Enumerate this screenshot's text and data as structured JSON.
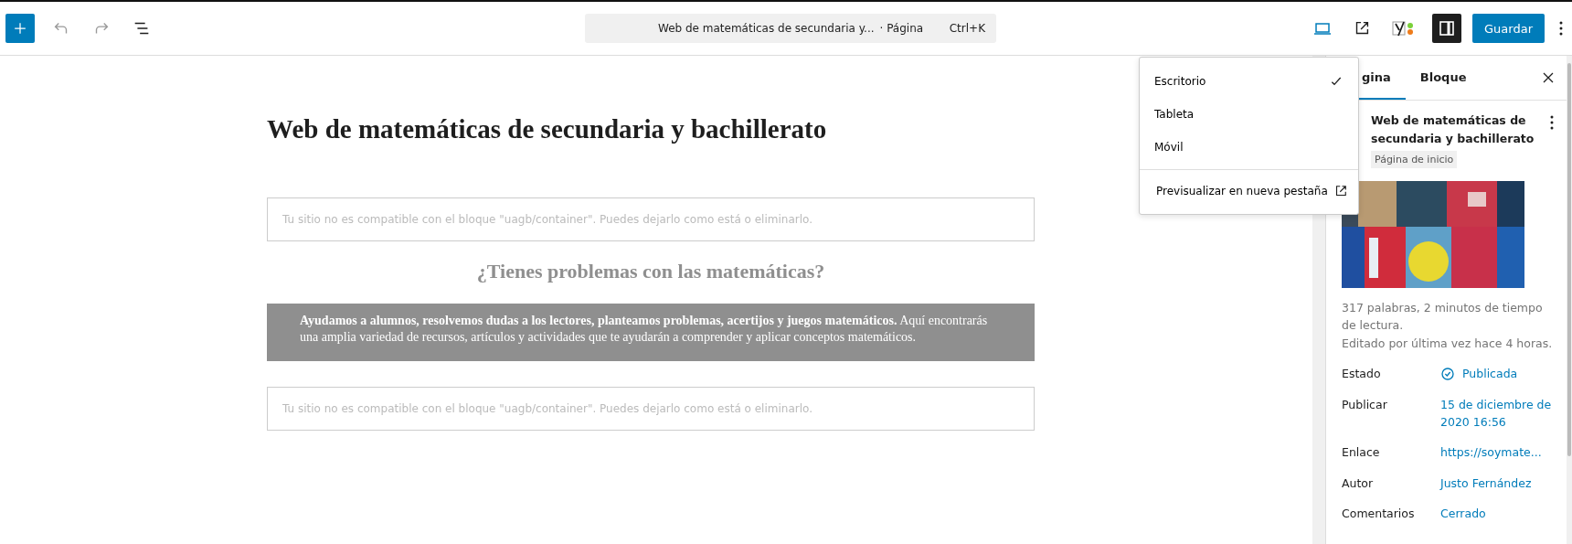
{
  "toolbar": {
    "command_bar": {
      "title": "Web de matemáticas de secundaria y...",
      "type": "· Página",
      "shortcut": "Ctrl+K"
    },
    "save_label": "Guardar"
  },
  "canvas": {
    "title": "Web de matemáticas de secundaria y bachillerato",
    "blocks": [
      {
        "kind": "notice",
        "text": "Tu sitio no es compatible con el bloque \"uagb/container\". Puedes dejarlo como está o eliminarlo."
      },
      {
        "kind": "heading",
        "text": "¿Tienes problemas con las matemáticas?"
      },
      {
        "kind": "banner",
        "text": "**Ayudamos a alumnos, resolvemos dudas a los lectores, planteamos problemas, acertijos y juegos matemáticos.** Aquí encontrarás una amplia variedad de recursos, artículos y actividades que te ayudarán a comprender y aplicar conceptos matemáticos."
      },
      {
        "kind": "notice",
        "text": "Tu sitio no es compatible con el bloque \"uagb/container\". Puedes dejarlo como está o eliminarlo."
      }
    ]
  },
  "preview_menu": {
    "items": [
      {
        "label": "Escritorio",
        "selected": true
      },
      {
        "label": "Tableta",
        "selected": false
      },
      {
        "label": "Móvil",
        "selected": false
      }
    ],
    "footer": "Previsualizar en nueva pestaña"
  },
  "sidebar": {
    "tabs": [
      {
        "label": "gina",
        "selected": true
      },
      {
        "label": "Bloque",
        "selected": false
      }
    ],
    "page_title": "Web de matemáticas de secundaria y bachillerato",
    "badge": "Página de inicio",
    "stats": "317 palabras, 2 minutos de tiempo de lectura.",
    "edited": "Editado por última vez hace 4 horas.",
    "rows": [
      {
        "label": "Estado",
        "value": "Publicada",
        "kind": "status"
      },
      {
        "label": "Publicar",
        "value": "15 de diciembre de 2020 16:56",
        "kind": "link"
      },
      {
        "label": "Enlace",
        "value": "https://soymate...",
        "kind": "link"
      },
      {
        "label": "Autor",
        "value": "Justo Fernández",
        "kind": "link"
      },
      {
        "label": "Comentarios",
        "value": "Cerrado",
        "kind": "link"
      }
    ]
  }
}
